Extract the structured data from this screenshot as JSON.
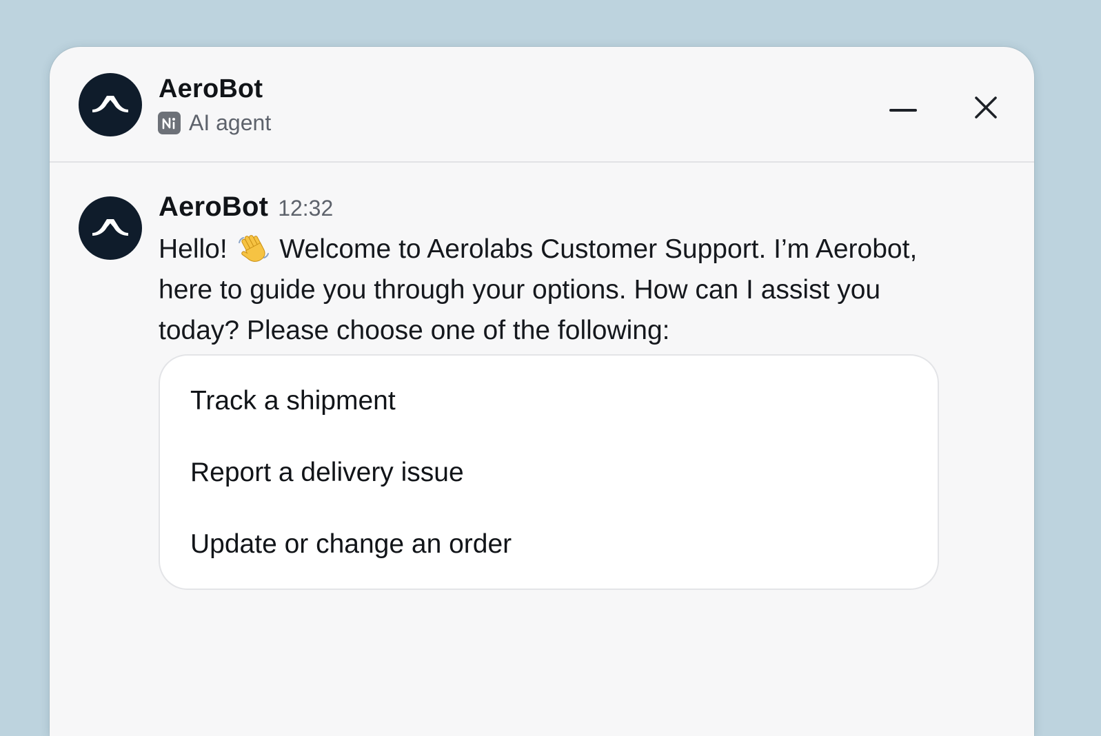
{
  "header": {
    "title": "AeroBot",
    "subtitle": "AI agent",
    "badge_icon": "ai-agent-icon",
    "minimize_icon": "minimize-icon",
    "close_icon": "close-icon"
  },
  "message": {
    "sender": "AeroBot",
    "time": "12:32",
    "text_before_emoji": "Hello!",
    "emoji": "waving-hand-emoji",
    "text_after_emoji": "Welcome to Aerolabs Customer Support. I’m Aerobot, here to guide you through your options. How can I assist you today? Please choose one of the following:",
    "options": [
      "Track a shipment",
      "Report a delivery issue",
      "Update or change an order"
    ]
  },
  "colors": {
    "background": "#bdd3de",
    "window": "#f7f7f8",
    "avatar": "#0f1c2b",
    "card": "#ffffff",
    "muted_text": "#5d626b"
  }
}
